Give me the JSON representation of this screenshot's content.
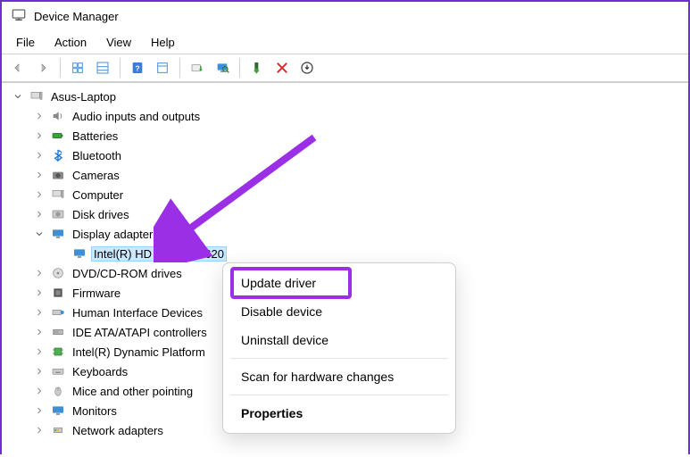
{
  "titlebar": {
    "title": "Device Manager"
  },
  "menubar": {
    "file": "File",
    "action": "Action",
    "view": "View",
    "help": "Help"
  },
  "toolbar": {
    "back": "back",
    "forward": "forward",
    "grid1": "view-small",
    "grid2": "view-large",
    "help": "help",
    "props": "properties",
    "update": "update-driver",
    "scan": "scan-pc",
    "add": "add-device",
    "remove": "remove-device",
    "install": "install"
  },
  "tree": {
    "root": {
      "label": "Asus-Laptop"
    },
    "items": [
      {
        "label": "Audio inputs and outputs",
        "icon": "speaker"
      },
      {
        "label": "Batteries",
        "icon": "battery"
      },
      {
        "label": "Bluetooth",
        "icon": "bluetooth"
      },
      {
        "label": "Cameras",
        "icon": "camera"
      },
      {
        "label": "Computer",
        "icon": "computer"
      },
      {
        "label": "Disk drives",
        "icon": "disk"
      },
      {
        "label": "Display adapters",
        "icon": "monitor",
        "expanded": true,
        "children": [
          {
            "label": "Intel(R) HD Graphics 620",
            "icon": "monitor",
            "selected": true
          }
        ]
      },
      {
        "label": "DVD/CD-ROM drives",
        "icon": "dvd"
      },
      {
        "label": "Firmware",
        "icon": "firmware"
      },
      {
        "label": "Human Interface Devices",
        "icon": "hid"
      },
      {
        "label": "IDE ATA/ATAPI controllers",
        "icon": "ide"
      },
      {
        "label": "Intel(R) Dynamic Platform",
        "icon": "chip"
      },
      {
        "label": "Keyboards",
        "icon": "keyboard"
      },
      {
        "label": "Mice and other pointing",
        "icon": "mouse"
      },
      {
        "label": "Monitors",
        "icon": "monitor2"
      },
      {
        "label": "Network adapters",
        "icon": "network"
      }
    ]
  },
  "context_menu": {
    "update": "Update driver",
    "disable": "Disable device",
    "uninstall": "Uninstall device",
    "scan": "Scan for hardware changes",
    "properties": "Properties"
  }
}
